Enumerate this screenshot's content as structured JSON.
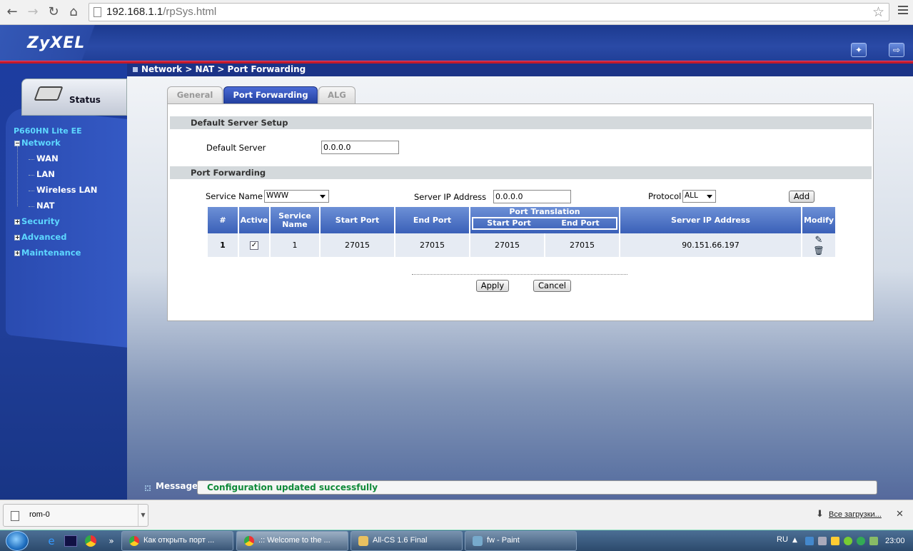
{
  "browser": {
    "url_host": "192.168.1.1",
    "url_path": "/rpSys.html"
  },
  "brand": {
    "logo": "ZyXEL"
  },
  "sidebar": {
    "status_label": "Status",
    "model": "P660HN Lite EE",
    "items": [
      {
        "label": "Network",
        "expanded": true
      },
      {
        "label": "WAN"
      },
      {
        "label": "LAN"
      },
      {
        "label": "Wireless LAN"
      },
      {
        "label": "NAT"
      },
      {
        "label": "Security",
        "expanded": false
      },
      {
        "label": "Advanced",
        "expanded": false
      },
      {
        "label": "Maintenance",
        "expanded": false
      }
    ]
  },
  "breadcrumb": "Network > NAT > Port Forwarding",
  "tabs": [
    {
      "label": "General",
      "active": false
    },
    {
      "label": "Port Forwarding",
      "active": true
    },
    {
      "label": "ALG",
      "active": false
    }
  ],
  "default_server": {
    "section_title": "Default Server Setup",
    "label": "Default Server",
    "value": "0.0.0.0"
  },
  "port_forwarding": {
    "section_title": "Port Forwarding",
    "service_name_label": "Service Name",
    "service_name_value": "WWW",
    "server_ip_label": "Server IP Address",
    "server_ip_value": "0.0.0.0",
    "protocol_label": "Protocol",
    "protocol_value": "ALL",
    "add_label": "Add",
    "columns": {
      "num": "#",
      "active": "Active",
      "service_name": "Service Name",
      "start_port": "Start Port",
      "end_port": "End Port",
      "port_translation": "Port Translation",
      "pt_start": "Start Port",
      "pt_end": "End Port",
      "server_ip": "Server IP Address",
      "modify": "Modify"
    },
    "rows": [
      {
        "num": "1",
        "active": true,
        "service_name": "1",
        "start_port": "27015",
        "end_port": "27015",
        "pt_start": "27015",
        "pt_end": "27015",
        "server_ip": "90.151.66.197"
      }
    ],
    "apply_label": "Apply",
    "cancel_label": "Cancel"
  },
  "message": {
    "label": "Message",
    "text": "Configuration updated successfully",
    "color": "#108a3a"
  },
  "downloads": {
    "item": "rom-0",
    "all_label": "Все загрузки..."
  },
  "taskbar": {
    "tasks": [
      {
        "label": "Как открыть порт ...",
        "active": false
      },
      {
        "label": ".:: Welcome to the ...",
        "active": true
      },
      {
        "label": "All-CS 1.6 Final",
        "active": false
      },
      {
        "label": "fw - Paint",
        "active": false
      }
    ],
    "lang": "RU",
    "clock": "23:00"
  },
  "colors": {
    "header_blue": "#1c3a8f",
    "accent_red": "#c21a2b",
    "tree_cyan": "#5dd7ff",
    "table_header": "#4a70c4"
  }
}
